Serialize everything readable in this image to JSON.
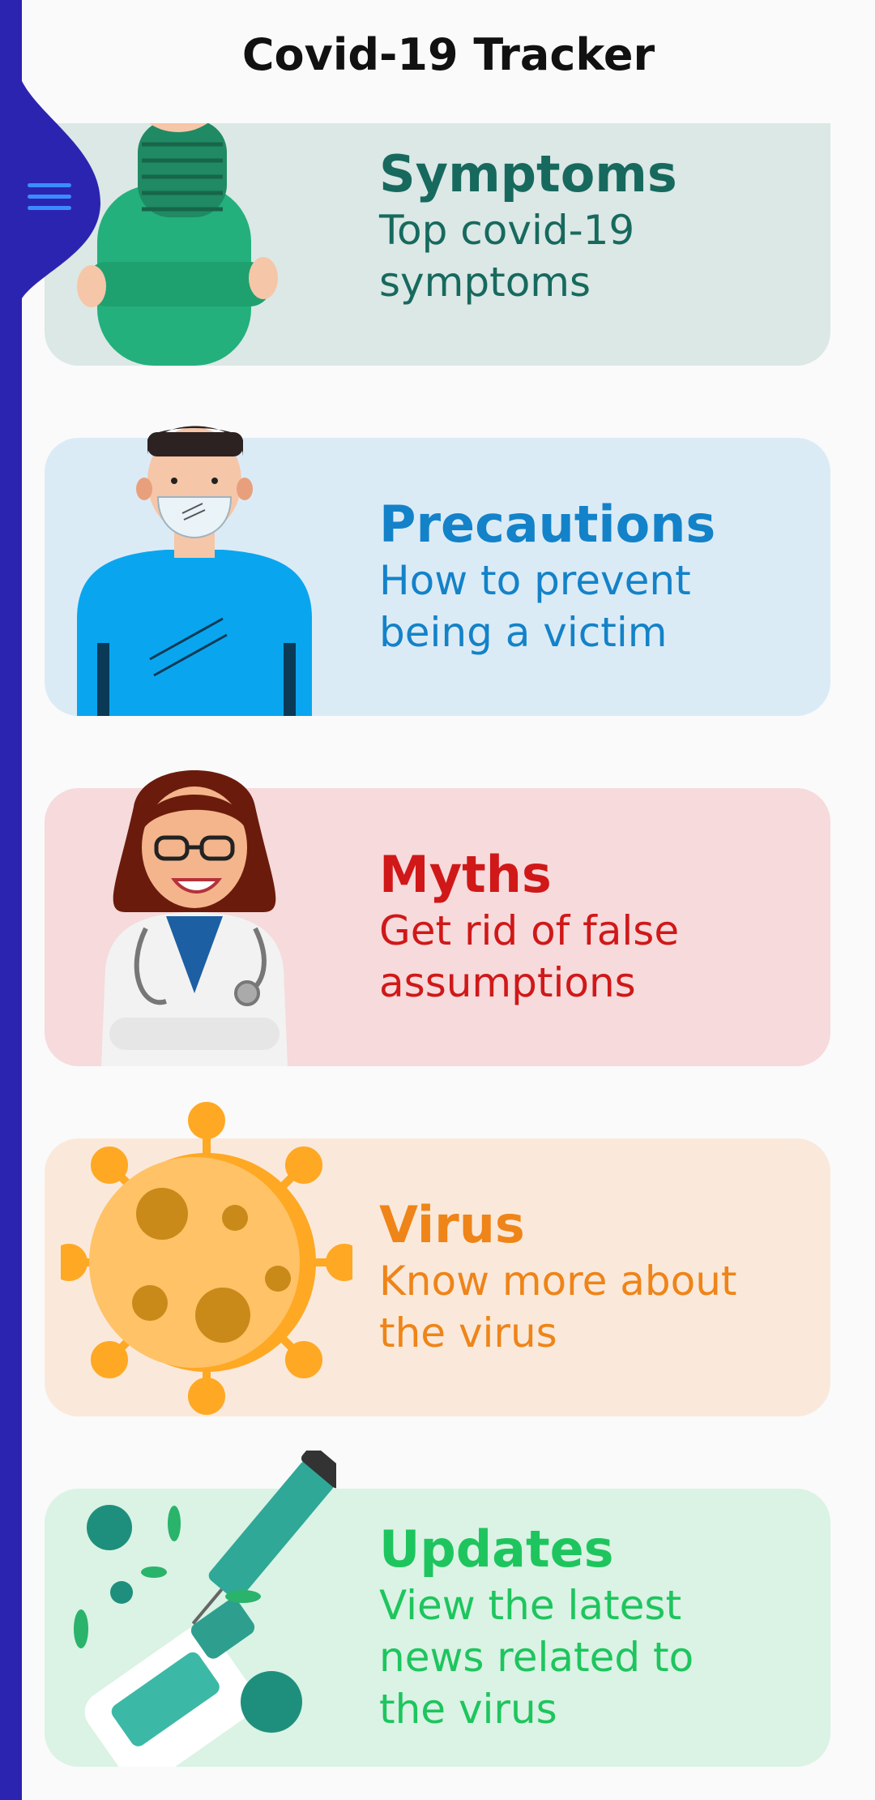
{
  "app": {
    "title": "Covid-19 Tracker"
  },
  "cards": [
    {
      "title": "Symptoms",
      "subtitle_lines": [
        "Top covid-19",
        "symptoms"
      ],
      "color": "#17695e",
      "background": "#dbe8e5",
      "icon": "sick-person-icon"
    },
    {
      "title": "Precautions",
      "subtitle_lines": [
        "How to prevent",
        "being a victim"
      ],
      "color": "#1382c9",
      "background": "#dbebf6",
      "icon": "masked-person-icon"
    },
    {
      "title": "Myths",
      "subtitle_lines": [
        "Get rid of false",
        "assumptions"
      ],
      "color": "#d01818",
      "background": "#f6dadc",
      "icon": "doctor-icon"
    },
    {
      "title": "Virus",
      "subtitle_lines": [
        "Know more about",
        "the virus"
      ],
      "color": "#ef8418",
      "background": "#fae9db",
      "icon": "virus-icon"
    },
    {
      "title": "Updates",
      "subtitle_lines": [
        "View the latest",
        "news related to",
        "the virus"
      ],
      "color": "#1ec55e",
      "background": "#daf3e4",
      "icon": "vaccine-icon"
    }
  ],
  "colors": {
    "side_strip": "#2b24b0",
    "menu_icon": "#3b8dff"
  },
  "menu": {
    "icon": "hamburger-menu-icon"
  }
}
